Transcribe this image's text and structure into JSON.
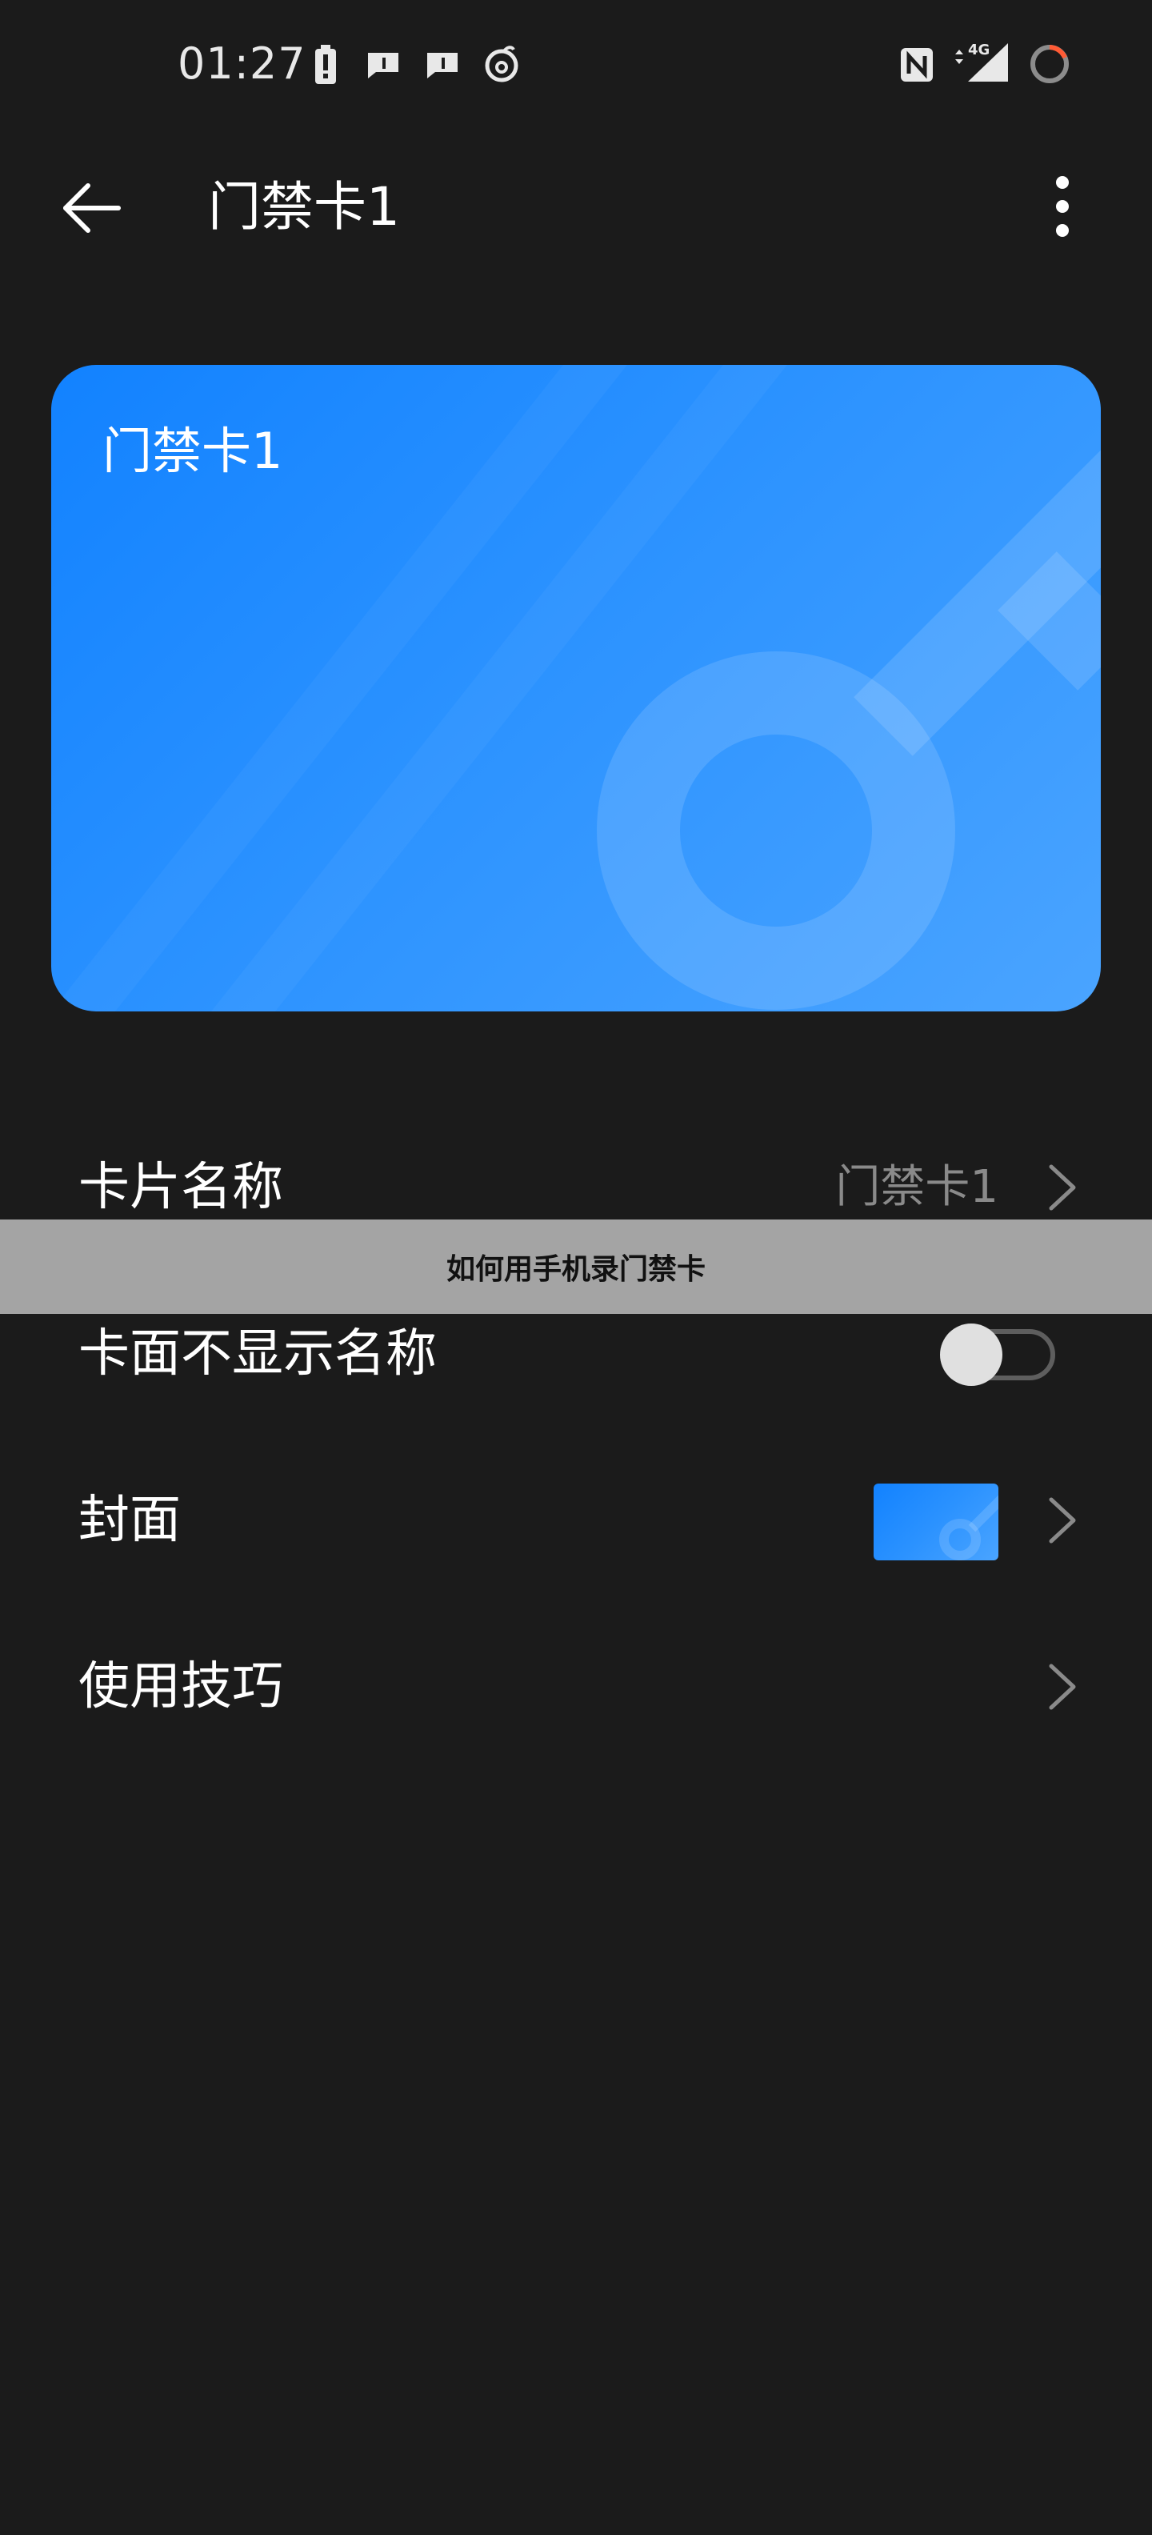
{
  "status_bar": {
    "time": "01:27",
    "network": "4G",
    "icons": [
      "battery-alert-icon",
      "message-icon",
      "message-icon",
      "netease-music-icon",
      "nfc-icon",
      "signal-4g-icon",
      "sync-ring-icon"
    ]
  },
  "app_bar": {
    "title": "门禁卡1",
    "back_icon": "arrow-left-icon",
    "more_icon": "more-vertical-icon"
  },
  "card": {
    "name": "门禁卡1",
    "art_icon": "key-icon"
  },
  "settings": {
    "items": [
      {
        "label": "卡片名称",
        "value": "门禁卡1",
        "type": "link"
      },
      {
        "label": "卡面不显示名称",
        "type": "toggle",
        "toggle_on": false
      },
      {
        "label": "封面",
        "type": "cover"
      },
      {
        "label": "使用技巧",
        "type": "link"
      }
    ]
  },
  "overlay": {
    "text": "如何用手机录门禁卡"
  },
  "colors": {
    "background": "#1b1b1b",
    "card_gradient_start": "#1282ff",
    "card_gradient_end": "#4aa4ff",
    "secondary_text": "#8a8a8a",
    "overlay_bg": "#a4a4a4"
  }
}
